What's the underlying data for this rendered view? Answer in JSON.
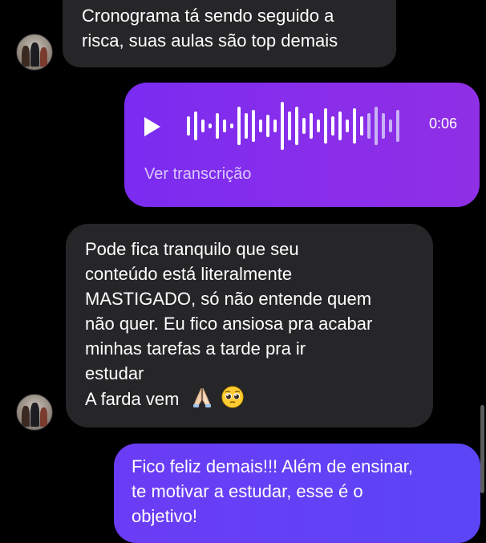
{
  "messages": [
    {
      "direction": "received",
      "text": "Cronograma tá sendo seguido a\nrisca, suas aulas são top demais"
    },
    {
      "direction": "sent",
      "type": "audio",
      "duration": "0:06",
      "transcript_link": "Ver transcrição"
    },
    {
      "direction": "received",
      "text": "Pode fica tranquilo que seu\nconteúdo está literalmente\nMASTIGADO, só não entende quem\nnão quer. Eu fico ansiosa pra acabar\nminhas tarefas a tarde pra ir\nestudar",
      "last_line": "A farda vem",
      "emojis": [
        "folded-hands-icon",
        "pleading-face-icon"
      ]
    },
    {
      "direction": "sent",
      "text": "Fico feliz demais!!! Além de ensinar,\nte motivar a estudar, esse é o\nobjetivo!"
    }
  ],
  "colors": {
    "background": "#000000",
    "received_bubble": "#262628",
    "sent_audio_bubble": "#8a2eea",
    "sent_text_bubble": "#5b45f7",
    "transcript_link": "#d9c8ff"
  },
  "icons": {
    "play": "play-icon",
    "avatar": "avatar"
  }
}
